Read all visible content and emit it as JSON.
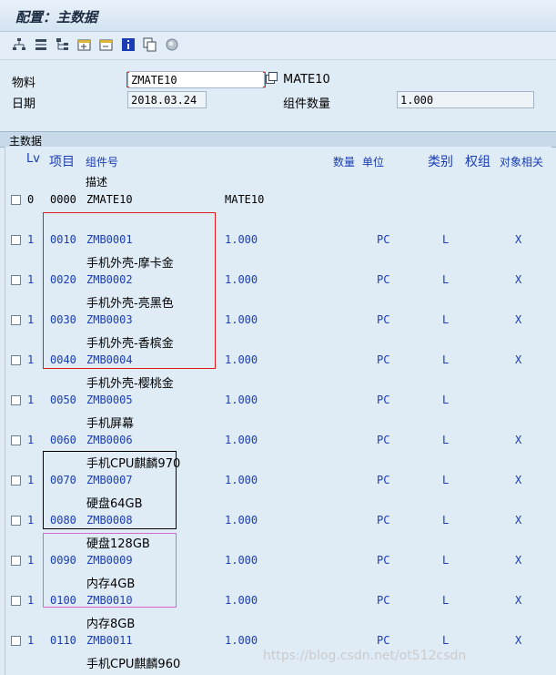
{
  "title": "配置：主数据",
  "toolbar": {
    "icons": [
      "structure-icon",
      "explode-icon",
      "hierarchy-icon",
      "expand-icon",
      "collapse-icon",
      "info-icon",
      "copy-icon",
      "status-icon"
    ]
  },
  "header": {
    "material_label": "物料",
    "material_value": "ZMATE10",
    "material_desc": "MATE10",
    "date_label": "日期",
    "date_value": "2018.03.24",
    "qty_label": "组件数量",
    "qty_value": "1.000"
  },
  "section": {
    "tab_label": "主数据",
    "columns": {
      "lv": "Lv",
      "item": "项目",
      "comp": "组件号",
      "desc": "描述",
      "qty": "数量",
      "unit": "单位",
      "cat": "类别",
      "grp": "权组",
      "rel": "对象相关"
    },
    "rows": [
      {
        "lv": "0",
        "item": "0000",
        "comp": "ZMATE10",
        "qty": "MATE10",
        "unit": "",
        "cat": "",
        "rel": "",
        "desc": ""
      },
      {
        "lv": "1",
        "item": "0010",
        "comp": "ZMB0001",
        "qty": "1.000",
        "unit": "PC",
        "cat": "L",
        "rel": "X",
        "desc": "手机外壳-摩卡金"
      },
      {
        "lv": "1",
        "item": "0020",
        "comp": "ZMB0002",
        "qty": "1.000",
        "unit": "PC",
        "cat": "L",
        "rel": "X",
        "desc": "手机外壳-亮黑色"
      },
      {
        "lv": "1",
        "item": "0030",
        "comp": "ZMB0003",
        "qty": "1.000",
        "unit": "PC",
        "cat": "L",
        "rel": "X",
        "desc": "手机外壳-香槟金"
      },
      {
        "lv": "1",
        "item": "0040",
        "comp": "ZMB0004",
        "qty": "1.000",
        "unit": "PC",
        "cat": "L",
        "rel": "X",
        "desc": "手机外壳-樱桃金"
      },
      {
        "lv": "1",
        "item": "0050",
        "comp": "ZMB0005",
        "qty": "1.000",
        "unit": "PC",
        "cat": "L",
        "rel": "",
        "desc": "手机屏幕"
      },
      {
        "lv": "1",
        "item": "0060",
        "comp": "ZMB0006",
        "qty": "1.000",
        "unit": "PC",
        "cat": "L",
        "rel": "X",
        "desc": "手机CPU麒麟970"
      },
      {
        "lv": "1",
        "item": "0070",
        "comp": "ZMB0007",
        "qty": "1.000",
        "unit": "PC",
        "cat": "L",
        "rel": "X",
        "desc": "硬盘64GB"
      },
      {
        "lv": "1",
        "item": "0080",
        "comp": "ZMB0008",
        "qty": "1.000",
        "unit": "PC",
        "cat": "L",
        "rel": "X",
        "desc": "硬盘128GB"
      },
      {
        "lv": "1",
        "item": "0090",
        "comp": "ZMB0009",
        "qty": "1.000",
        "unit": "PC",
        "cat": "L",
        "rel": "X",
        "desc": "内存4GB"
      },
      {
        "lv": "1",
        "item": "0100",
        "comp": "ZMB0010",
        "qty": "1.000",
        "unit": "PC",
        "cat": "L",
        "rel": "X",
        "desc": "内存8GB"
      },
      {
        "lv": "1",
        "item": "0110",
        "comp": "ZMB0011",
        "qty": "1.000",
        "unit": "PC",
        "cat": "L",
        "rel": "X",
        "desc": "手机CPU麒麟960"
      }
    ]
  },
  "watermark": "https://blog.csdn.net/ot512csdn",
  "colors": {
    "highlight_red": "#e01919",
    "highlight_black": "#000000",
    "highlight_magenta": "#d864d8",
    "link_blue": "#1a3db5"
  }
}
